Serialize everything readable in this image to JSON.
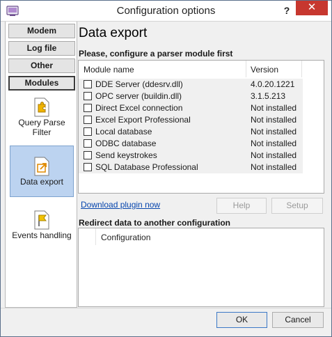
{
  "window": {
    "title": "Configuration options",
    "help_label": "?",
    "close_label": "✕"
  },
  "nav": {
    "buttons": [
      {
        "label": "Modem"
      },
      {
        "label": "Log file"
      },
      {
        "label": "Other"
      },
      {
        "label": "Modules",
        "active": true
      }
    ],
    "tiles": [
      {
        "label": "Query Parse Filter",
        "icon": "puzzle-icon"
      },
      {
        "label": "Data export",
        "icon": "export-icon",
        "selected": true
      },
      {
        "label": "Events handling",
        "icon": "flag-document-icon"
      }
    ]
  },
  "main": {
    "heading": "Data export",
    "parser_label": "Please, configure a parser module first",
    "modules_table": {
      "columns": [
        "Module name",
        "Version"
      ],
      "rows": [
        {
          "name": "DDE Server (ddesrv.dll)",
          "version": "4.0.20.1221",
          "checked": false
        },
        {
          "name": "OPC server (buildin.dll)",
          "version": "3.1.5.213",
          "checked": false
        },
        {
          "name": "Direct Excel connection",
          "version": "Not installed",
          "checked": false
        },
        {
          "name": "Excel Export Professional",
          "version": "Not installed",
          "checked": false
        },
        {
          "name": "Local database",
          "version": "Not installed",
          "checked": false
        },
        {
          "name": "ODBC database",
          "version": "Not installed",
          "checked": false
        },
        {
          "name": "Send keystrokes",
          "version": "Not installed",
          "checked": false
        },
        {
          "name": "SQL Database Professional",
          "version": "Not installed",
          "checked": false
        }
      ]
    },
    "download_link": "Download plugin now",
    "help_button": "Help",
    "setup_button": "Setup",
    "redirect_label": "Redirect data to another configuration",
    "redirect_table": {
      "columns": [
        "Configuration"
      ]
    }
  },
  "footer": {
    "ok_label": "OK",
    "cancel_label": "Cancel"
  },
  "colors": {
    "accent_selected": "#bcd3f0",
    "close_red": "#c7372f",
    "link": "#0645ad"
  }
}
